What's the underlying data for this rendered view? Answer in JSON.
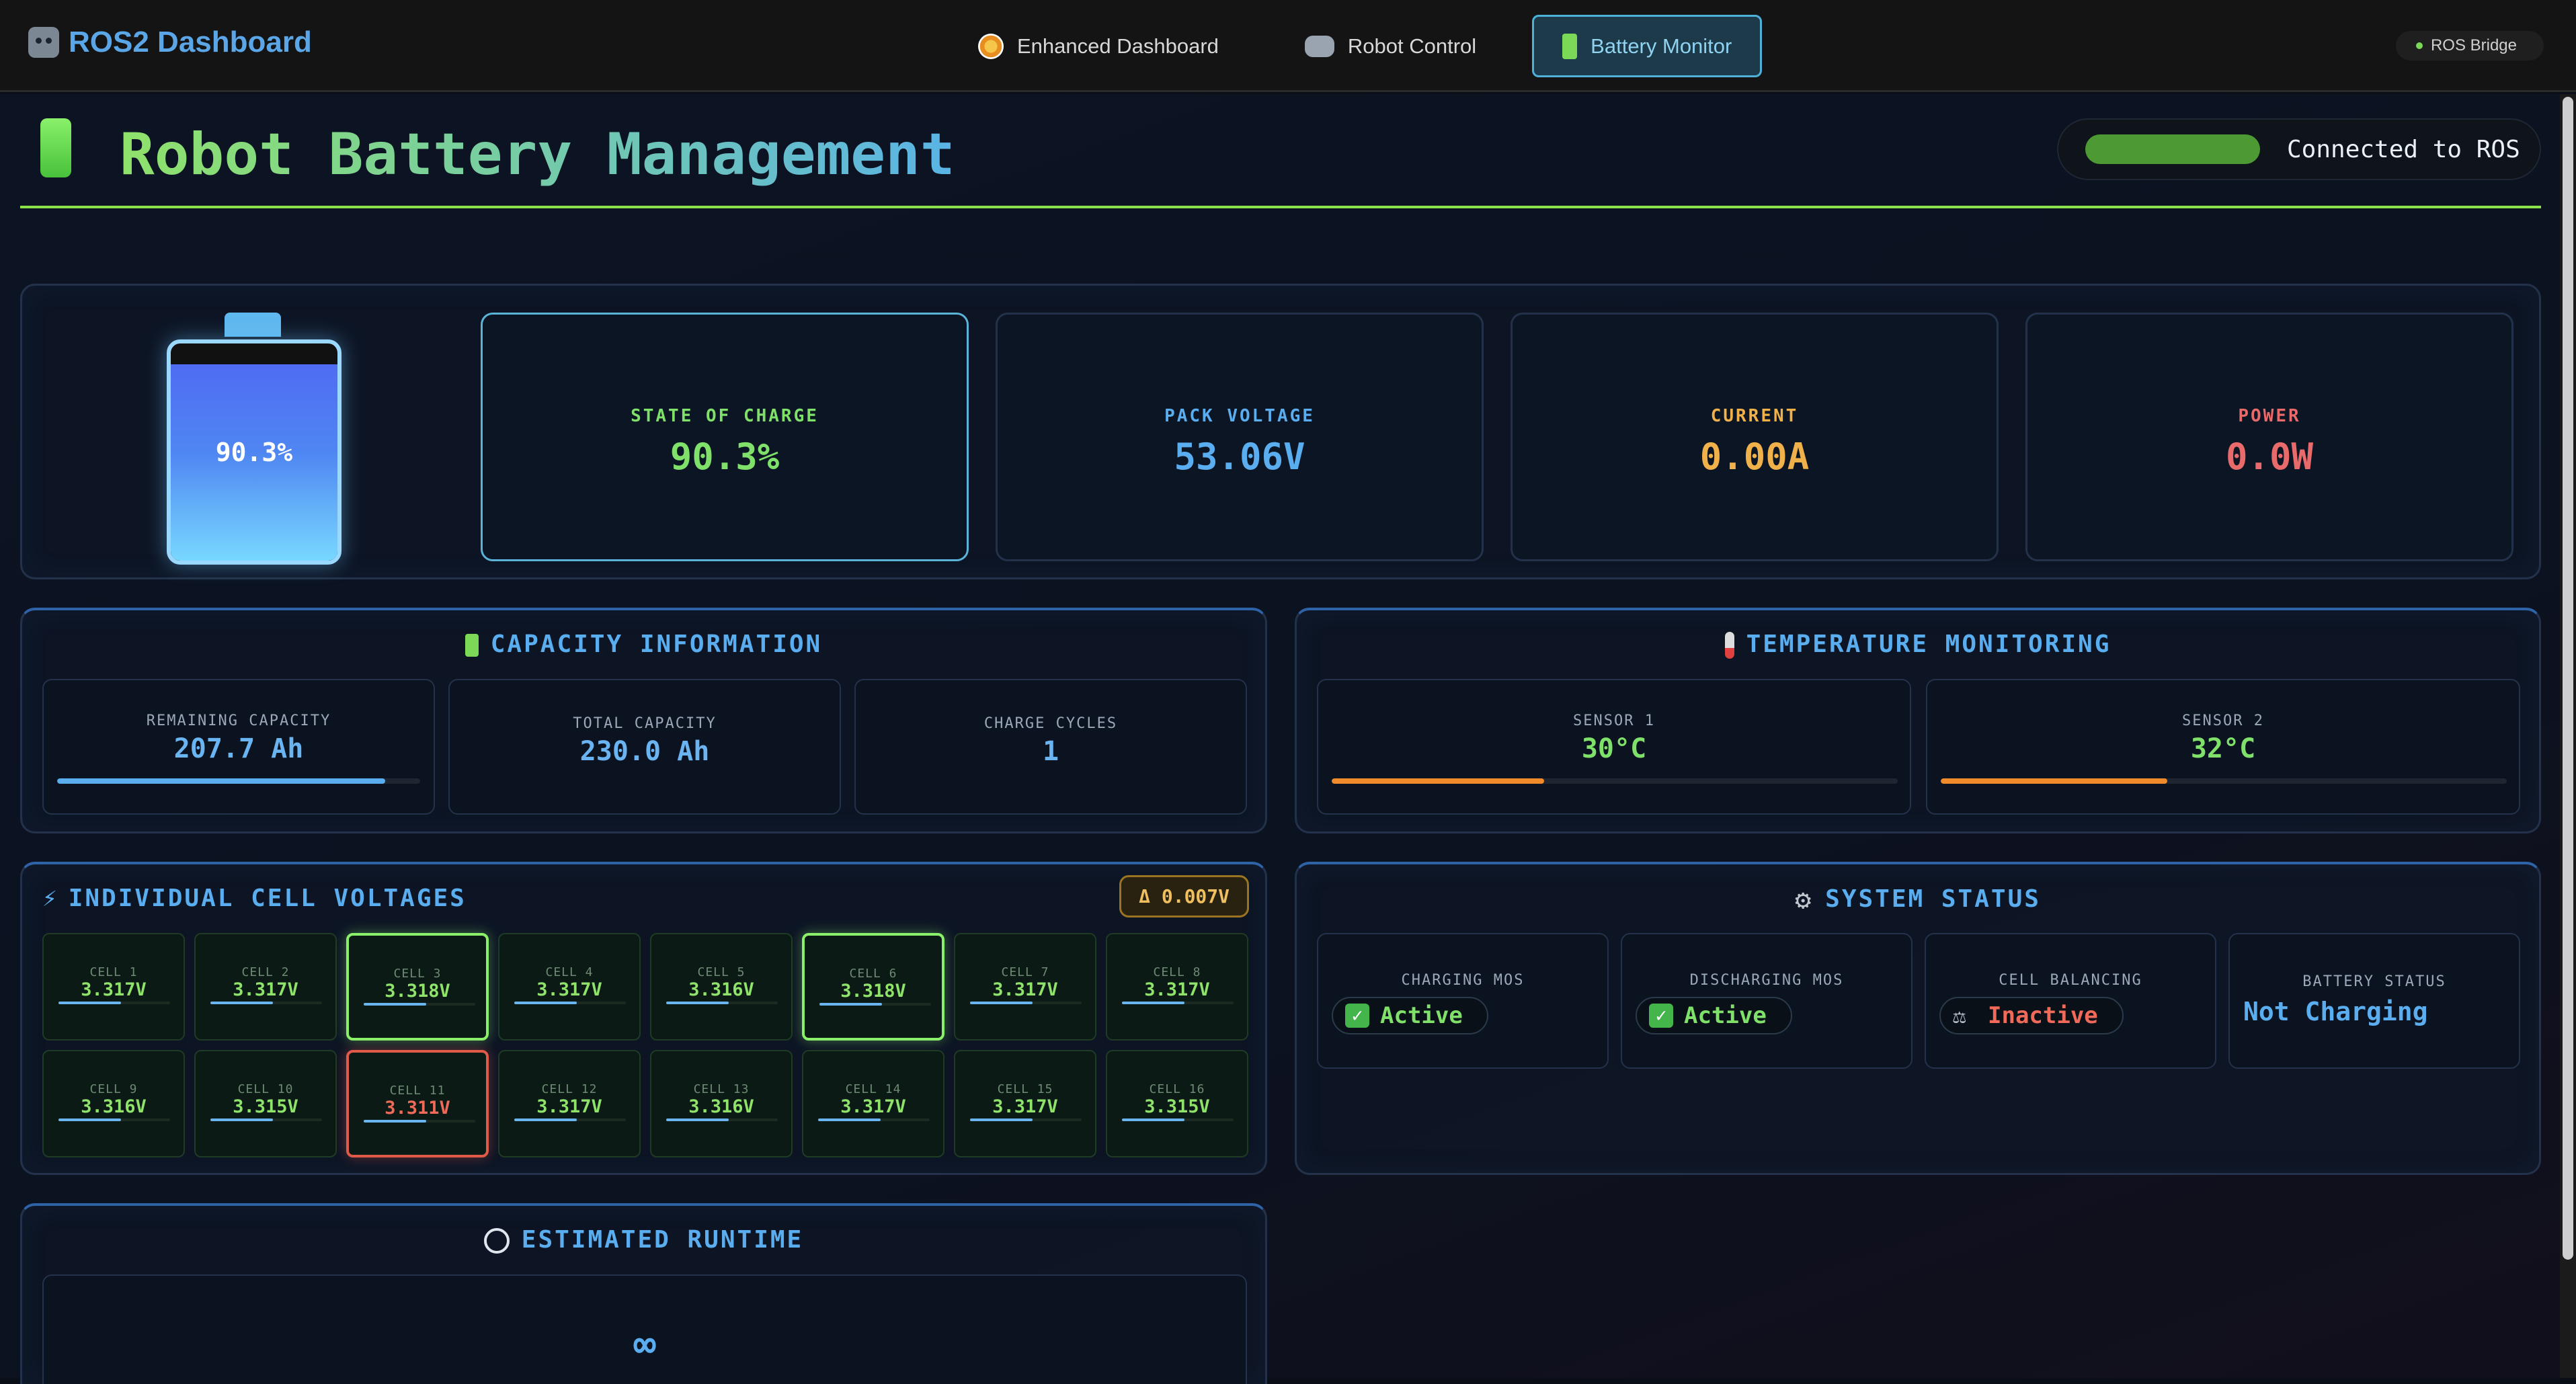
{
  "nav": {
    "brand": "ROS2 Dashboard",
    "links": [
      {
        "label": "Enhanced Dashboard",
        "icon": "compass-icon"
      },
      {
        "label": "Robot Control",
        "icon": "gamepad-icon"
      },
      {
        "label": "Battery Monitor",
        "icon": "battery-icon",
        "active": true
      }
    ],
    "bridge_label": "ROS Bridge"
  },
  "header": {
    "title": "Robot Battery Management",
    "connection": "Connected to ROS"
  },
  "overview": {
    "battery_percent_label": "90.3%",
    "battery_level": 0.903,
    "stats": [
      {
        "label": "STATE OF CHARGE",
        "value": "90.3%",
        "color": "#7fe06a"
      },
      {
        "label": "PACK VOLTAGE",
        "value": "53.06V",
        "color": "#5aaef0"
      },
      {
        "label": "CURRENT",
        "value": "0.00A",
        "color": "#f0b04a"
      },
      {
        "label": "POWER",
        "value": "0.0W",
        "color": "#e86a6a"
      }
    ]
  },
  "capacity": {
    "title": "CAPACITY INFORMATION",
    "remaining_label": "REMAINING CAPACITY",
    "remaining_value": "207.7 Ah",
    "remaining_fraction": 0.903,
    "total_label": "TOTAL CAPACITY",
    "total_value": "230.0 Ah",
    "cycles_label": "CHARGE CYCLES",
    "cycles_value": "1"
  },
  "temperature": {
    "title": "TEMPERATURE MONITORING",
    "sensors": [
      {
        "label": "SENSOR 1",
        "value": "30°C",
        "fraction": 0.375
      },
      {
        "label": "SENSOR 2",
        "value": "32°C",
        "fraction": 0.4
      }
    ]
  },
  "cells": {
    "title": "INDIVIDUAL CELL VOLTAGES",
    "delta": "Δ 0.007V",
    "items": [
      {
        "label": "CELL 1",
        "value": "3.317V",
        "state": "normal"
      },
      {
        "label": "CELL 2",
        "value": "3.317V",
        "state": "normal"
      },
      {
        "label": "CELL 3",
        "value": "3.318V",
        "state": "high"
      },
      {
        "label": "CELL 4",
        "value": "3.317V",
        "state": "normal"
      },
      {
        "label": "CELL 5",
        "value": "3.316V",
        "state": "normal"
      },
      {
        "label": "CELL 6",
        "value": "3.318V",
        "state": "high"
      },
      {
        "label": "CELL 7",
        "value": "3.317V",
        "state": "normal"
      },
      {
        "label": "CELL 8",
        "value": "3.317V",
        "state": "normal"
      },
      {
        "label": "CELL 9",
        "value": "3.316V",
        "state": "normal"
      },
      {
        "label": "CELL 10",
        "value": "3.315V",
        "state": "normal"
      },
      {
        "label": "CELL 11",
        "value": "3.311V",
        "state": "low"
      },
      {
        "label": "CELL 12",
        "value": "3.317V",
        "state": "normal"
      },
      {
        "label": "CELL 13",
        "value": "3.316V",
        "state": "normal"
      },
      {
        "label": "CELL 14",
        "value": "3.317V",
        "state": "normal"
      },
      {
        "label": "CELL 15",
        "value": "3.317V",
        "state": "normal"
      },
      {
        "label": "CELL 16",
        "value": "3.315V",
        "state": "normal"
      }
    ]
  },
  "system": {
    "title": "SYSTEM STATUS",
    "items": [
      {
        "label": "CHARGING MOS",
        "value": "Active",
        "color": "#7fe06a",
        "icon": "check-icon"
      },
      {
        "label": "DISCHARGING MOS",
        "value": "Active",
        "color": "#7fe06a",
        "icon": "check-icon"
      },
      {
        "label": "CELL BALANCING",
        "value": "Inactive",
        "color": "#f06a5a",
        "icon": "scale-icon"
      },
      {
        "label": "BATTERY STATUS",
        "value": "Not Charging",
        "color": "#5aaef0",
        "icon": ""
      }
    ]
  },
  "runtime": {
    "title": "ESTIMATED RUNTIME",
    "value": "∞"
  }
}
